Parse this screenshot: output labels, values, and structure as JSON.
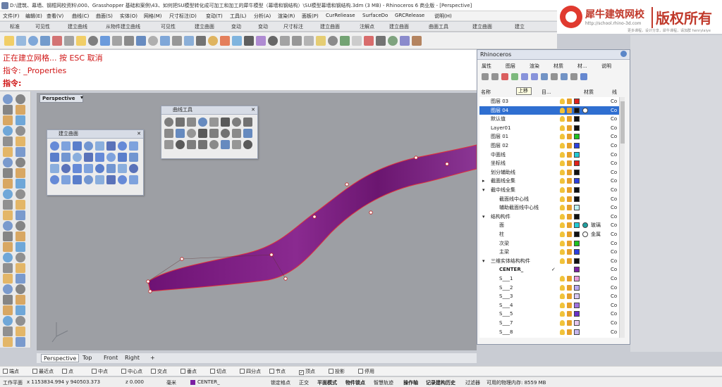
{
  "window": {
    "title": "D:\\建筑、幕墙、钢框网校资料\\000、Grasshopper 基础和案例\\43、如何把SU模型转化成可加工和加工的犀牛模型（幕墙和钢结构）\\SU模型幕墙和钢结构.3dm (3 MB) - Rhinoceros 6 商业版 - [Perspective]"
  },
  "menubar": [
    "文件(F)",
    "编辑(E)",
    "查看(V)",
    "曲线(C)",
    "曲面(S)",
    "实体(O)",
    "网格(M)",
    "尺寸标注(D)",
    "变动(T)",
    "工具(L)",
    "分析(A)",
    "渲染(R)",
    "面板(P)",
    "CurReliease",
    "SurfaceDo",
    "GRCRelease",
    "说明(H)"
  ],
  "logo": {
    "name": "犀牛建筑网校",
    "copyright": "版权所有",
    "url": "http://school.rhino-3d.com",
    "tagline": "更多课程，设计分享，犀牛课程，请加群",
    "handle": "henrylaiye"
  },
  "tabstrip": [
    "标准",
    "可见性",
    "建立曲线",
    "从物件建立曲线",
    "可见性",
    "建立曲面",
    "变动",
    "变动",
    "尺寸标注",
    "建立曲面",
    "注解点",
    "建立曲面",
    "曲面工具",
    "建立曲面",
    "建立"
  ],
  "command": {
    "line1": "正在建立网格... 按 ESC 取消",
    "line2": "指令: _Properties",
    "line3": "指令:"
  },
  "viewport": {
    "name": "Perspective",
    "dropdown": "▾"
  },
  "panels": {
    "curve_tools": "曲线工具",
    "surface_create": "建立曲面"
  },
  "rhino_panel": {
    "title": "Rhinoceros",
    "tabs": [
      "属性",
      "图层",
      "渲染",
      "材质",
      "材...",
      "说明"
    ],
    "tooltip": "上移",
    "columns": [
      "名称",
      "目...",
      "材质",
      "线"
    ]
  },
  "layers": [
    {
      "name": "图层 03",
      "indent": 0,
      "color": "#e0221b",
      "mat": "",
      "sel": false
    },
    {
      "name": "图层 04",
      "indent": 0,
      "color": "#111111",
      "mat": "",
      "sel": true
    },
    {
      "name": "默认值",
      "indent": 0,
      "color": "#111111",
      "mat": "",
      "sel": false
    },
    {
      "name": "Layer01",
      "indent": 0,
      "color": "#111111",
      "mat": "",
      "sel": false
    },
    {
      "name": "图层 01",
      "indent": 0,
      "color": "#1fc21f",
      "mat": "",
      "sel": false
    },
    {
      "name": "图层 02",
      "indent": 0,
      "color": "#2c3fe0",
      "mat": "",
      "sel": false
    },
    {
      "name": "中面线",
      "indent": 0,
      "color": "#22c9d4",
      "mat": "",
      "sel": false
    },
    {
      "name": "坐标线",
      "indent": 0,
      "color": "#e0221b",
      "mat": "",
      "sel": false
    },
    {
      "name": "划分辅助线",
      "indent": 0,
      "color": "#111111",
      "mat": "",
      "sel": false
    },
    {
      "name": "截面线全集",
      "indent": 0,
      "color": "#2c3fe0",
      "mat": "",
      "sel": false,
      "tw": "▸"
    },
    {
      "name": "截中线全集",
      "indent": 0,
      "color": "#111111",
      "mat": "",
      "sel": false,
      "tw": "▾"
    },
    {
      "name": "截面线中心线",
      "indent": 1,
      "color": "#111111",
      "mat": "",
      "sel": false
    },
    {
      "name": "辅助截面线中心线",
      "indent": 1,
      "color": "#bff2f2",
      "mat": "",
      "sel": false
    },
    {
      "name": "结构构件",
      "indent": 0,
      "color": "#111111",
      "mat": "",
      "sel": false,
      "tw": "▾"
    },
    {
      "name": "面",
      "indent": 1,
      "color": "#22c9d4",
      "mat": "玻璃",
      "matc": "#1fa0a0",
      "sel": false
    },
    {
      "name": "柱",
      "indent": 1,
      "color": "#111111",
      "mat": "金属",
      "matc": "#ffffff",
      "sel": false
    },
    {
      "name": "次梁",
      "indent": 1,
      "color": "#1fc21f",
      "mat": "",
      "sel": false
    },
    {
      "name": "主梁",
      "indent": 1,
      "color": "#2c3fe0",
      "mat": "",
      "sel": false
    },
    {
      "name": "三维实体结构构件",
      "indent": 0,
      "color": "#111111",
      "mat": "",
      "sel": false,
      "tw": "▾"
    },
    {
      "name": "CENTER_",
      "indent": 1,
      "color": "#7b1fa2",
      "mat": "",
      "sel": false,
      "bold": true
    },
    {
      "name": "S___1",
      "indent": 1,
      "color": "#e89ad8",
      "mat": "",
      "sel": false
    },
    {
      "name": "S___2",
      "indent": 1,
      "color": "#b8a8f0",
      "mat": "",
      "sel": false
    },
    {
      "name": "S___3",
      "indent": 1,
      "color": "#d8c8f4",
      "mat": "",
      "sel": false
    },
    {
      "name": "S___4",
      "indent": 1,
      "color": "#a070e0",
      "mat": "",
      "sel": false
    },
    {
      "name": "S___5",
      "indent": 1,
      "color": "#6a30c8",
      "mat": "",
      "sel": false
    },
    {
      "name": "S___7",
      "indent": 1,
      "color": "#e6c6f0",
      "mat": "",
      "sel": false
    },
    {
      "name": "S___8",
      "indent": 1,
      "color": "#c6b6ee",
      "mat": "",
      "sel": false
    }
  ],
  "view_tabs": [
    "Perspective",
    "Top",
    "Front",
    "Right",
    "+"
  ],
  "osnaps": [
    {
      "label": "端点",
      "checked": false
    },
    {
      "label": "最近点",
      "checked": false
    },
    {
      "label": "点",
      "checked": false
    },
    {
      "label": "中点",
      "checked": false
    },
    {
      "label": "中心点",
      "checked": false
    },
    {
      "label": "交点",
      "checked": false
    },
    {
      "label": "垂点",
      "checked": false
    },
    {
      "label": "切点",
      "checked": false
    },
    {
      "label": "四分点",
      "checked": false
    },
    {
      "label": "节点",
      "checked": false
    },
    {
      "label": "顶点",
      "checked": true
    },
    {
      "label": "投影",
      "checked": false
    },
    {
      "label": "停用",
      "checked": false
    }
  ],
  "status": {
    "workplane": "工作平面",
    "coords": "x 1153834.994  y 940503.373",
    "z": "z 0.000",
    "unit": "毫米",
    "layer": "CENTER_",
    "grid_snap": "锁定格点",
    "ortho": "正交",
    "planar": "平面模式",
    "osnap": "物件锁点",
    "smarttrack": "智慧轨迹",
    "gumball": "操作轴",
    "history": "记录建构历史",
    "filter": "过滤器",
    "memory": "可用的物理内存: 8559 MB"
  },
  "colors": {
    "surface": "#7d1c82",
    "edge": "#e0303a",
    "accent": "#2f6fd1"
  }
}
